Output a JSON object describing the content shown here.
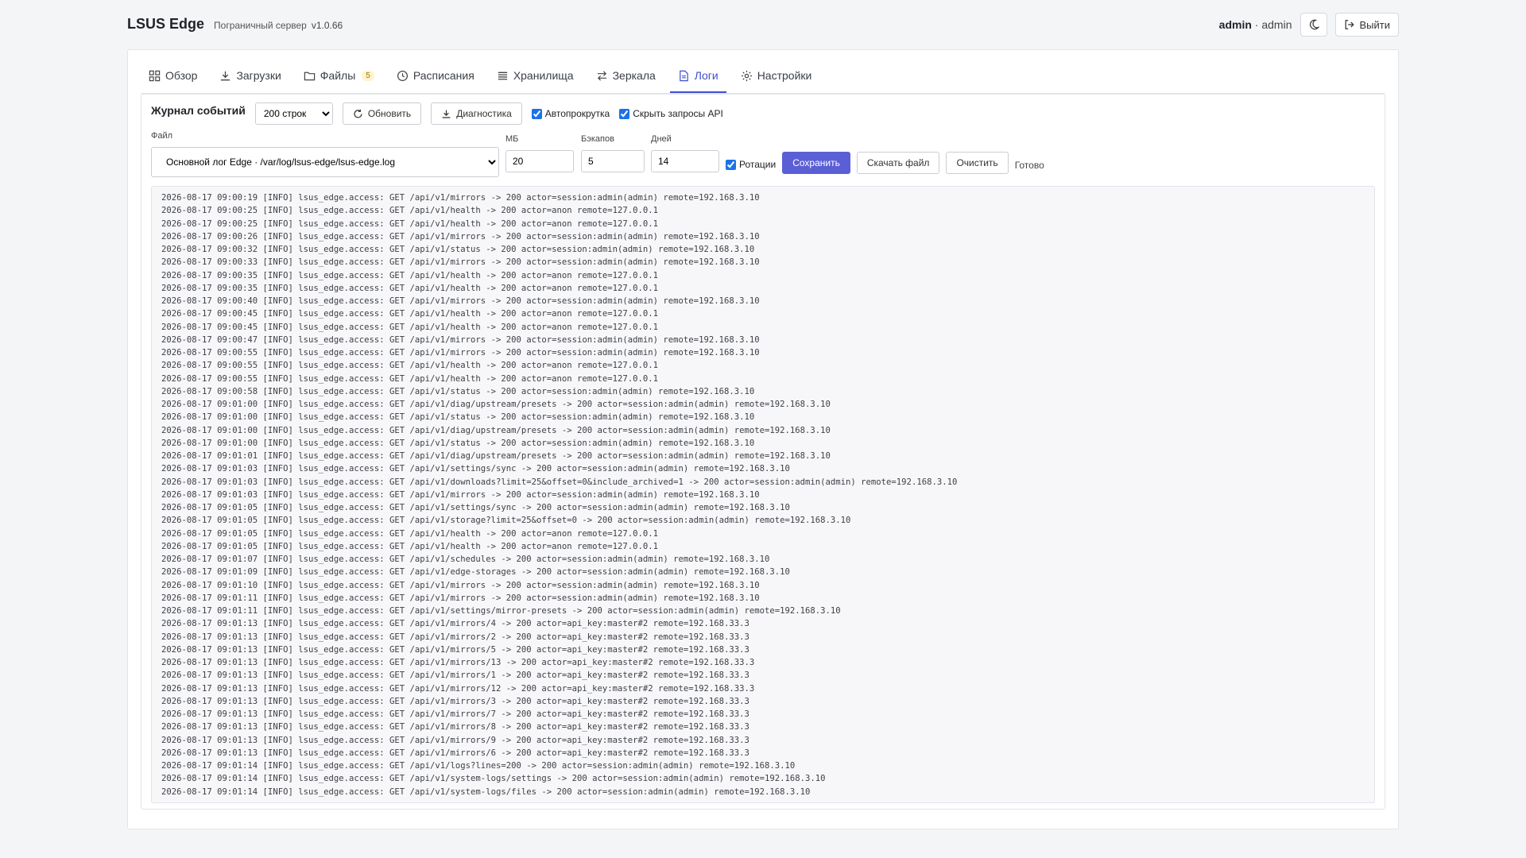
{
  "header": {
    "title": "LSUS Edge",
    "subtitle": "Пограничный сервер",
    "version": "v1.0.66",
    "user_name": "admin",
    "user_role": "admin",
    "logout_label": "Выйти"
  },
  "tabs": [
    {
      "label": "Обзор",
      "icon": "grid-icon"
    },
    {
      "label": "Загрузки",
      "icon": "download-icon"
    },
    {
      "label": "Файлы",
      "icon": "folder-icon",
      "badge": "5"
    },
    {
      "label": "Расписания",
      "icon": "clock-icon"
    },
    {
      "label": "Хранилища",
      "icon": "list-icon"
    },
    {
      "label": "Зеркала",
      "icon": "arrows-icon"
    },
    {
      "label": "Логи",
      "icon": "document-icon",
      "active": true
    },
    {
      "label": "Настройки",
      "icon": "gear-icon"
    }
  ],
  "logs": {
    "title": "Журнал событий",
    "lines_select": "200 строк",
    "refresh_label": "Обновить",
    "diagnostics_label": "Диагностика",
    "autoscroll_label": "Автопрокрутка",
    "hide_api_label": "Скрыть запросы API",
    "file_label": "Файл",
    "file_value": "Основной лог Edge · /var/log/lsus-edge/lsus-edge.log",
    "mb_label": "МБ",
    "mb_value": "20",
    "backups_label": "Бэкапов",
    "backups_value": "5",
    "days_label": "Дней",
    "days_value": "14",
    "rotation_label": "Ротации",
    "save_label": "Сохранить",
    "download_label": "Скачать файл",
    "clear_label": "Очистить",
    "status": "Готово",
    "accent_color": "#5b5fd6",
    "lines": [
      "2026-08-17 09:00:19 [INFO] lsus_edge.access: GET /api/v1/mirrors -> 200 actor=session:admin(admin) remote=192.168.3.10",
      "2026-08-17 09:00:25 [INFO] lsus_edge.access: GET /api/v1/health -> 200 actor=anon remote=127.0.0.1",
      "2026-08-17 09:00:25 [INFO] lsus_edge.access: GET /api/v1/health -> 200 actor=anon remote=127.0.0.1",
      "2026-08-17 09:00:26 [INFO] lsus_edge.access: GET /api/v1/mirrors -> 200 actor=session:admin(admin) remote=192.168.3.10",
      "2026-08-17 09:00:32 [INFO] lsus_edge.access: GET /api/v1/status -> 200 actor=session:admin(admin) remote=192.168.3.10",
      "2026-08-17 09:00:33 [INFO] lsus_edge.access: GET /api/v1/mirrors -> 200 actor=session:admin(admin) remote=192.168.3.10",
      "2026-08-17 09:00:35 [INFO] lsus_edge.access: GET /api/v1/health -> 200 actor=anon remote=127.0.0.1",
      "2026-08-17 09:00:35 [INFO] lsus_edge.access: GET /api/v1/health -> 200 actor=anon remote=127.0.0.1",
      "2026-08-17 09:00:40 [INFO] lsus_edge.access: GET /api/v1/mirrors -> 200 actor=session:admin(admin) remote=192.168.3.10",
      "2026-08-17 09:00:45 [INFO] lsus_edge.access: GET /api/v1/health -> 200 actor=anon remote=127.0.0.1",
      "2026-08-17 09:00:45 [INFO] lsus_edge.access: GET /api/v1/health -> 200 actor=anon remote=127.0.0.1",
      "2026-08-17 09:00:47 [INFO] lsus_edge.access: GET /api/v1/mirrors -> 200 actor=session:admin(admin) remote=192.168.3.10",
      "2026-08-17 09:00:55 [INFO] lsus_edge.access: GET /api/v1/mirrors -> 200 actor=session:admin(admin) remote=192.168.3.10",
      "2026-08-17 09:00:55 [INFO] lsus_edge.access: GET /api/v1/health -> 200 actor=anon remote=127.0.0.1",
      "2026-08-17 09:00:55 [INFO] lsus_edge.access: GET /api/v1/health -> 200 actor=anon remote=127.0.0.1",
      "2026-08-17 09:00:58 [INFO] lsus_edge.access: GET /api/v1/status -> 200 actor=session:admin(admin) remote=192.168.3.10",
      "2026-08-17 09:01:00 [INFO] lsus_edge.access: GET /api/v1/diag/upstream/presets -> 200 actor=session:admin(admin) remote=192.168.3.10",
      "2026-08-17 09:01:00 [INFO] lsus_edge.access: GET /api/v1/status -> 200 actor=session:admin(admin) remote=192.168.3.10",
      "2026-08-17 09:01:00 [INFO] lsus_edge.access: GET /api/v1/diag/upstream/presets -> 200 actor=session:admin(admin) remote=192.168.3.10",
      "2026-08-17 09:01:00 [INFO] lsus_edge.access: GET /api/v1/status -> 200 actor=session:admin(admin) remote=192.168.3.10",
      "2026-08-17 09:01:01 [INFO] lsus_edge.access: GET /api/v1/diag/upstream/presets -> 200 actor=session:admin(admin) remote=192.168.3.10",
      "2026-08-17 09:01:03 [INFO] lsus_edge.access: GET /api/v1/settings/sync -> 200 actor=session:admin(admin) remote=192.168.3.10",
      "2026-08-17 09:01:03 [INFO] lsus_edge.access: GET /api/v1/downloads?limit=25&offset=0&include_archived=1 -> 200 actor=session:admin(admin) remote=192.168.3.10",
      "2026-08-17 09:01:03 [INFO] lsus_edge.access: GET /api/v1/mirrors -> 200 actor=session:admin(admin) remote=192.168.3.10",
      "2026-08-17 09:01:05 [INFO] lsus_edge.access: GET /api/v1/settings/sync -> 200 actor=session:admin(admin) remote=192.168.3.10",
      "2026-08-17 09:01:05 [INFO] lsus_edge.access: GET /api/v1/storage?limit=25&offset=0 -> 200 actor=session:admin(admin) remote=192.168.3.10",
      "2026-08-17 09:01:05 [INFO] lsus_edge.access: GET /api/v1/health -> 200 actor=anon remote=127.0.0.1",
      "2026-08-17 09:01:05 [INFO] lsus_edge.access: GET /api/v1/health -> 200 actor=anon remote=127.0.0.1",
      "2026-08-17 09:01:07 [INFO] lsus_edge.access: GET /api/v1/schedules -> 200 actor=session:admin(admin) remote=192.168.3.10",
      "2026-08-17 09:01:09 [INFO] lsus_edge.access: GET /api/v1/edge-storages -> 200 actor=session:admin(admin) remote=192.168.3.10",
      "2026-08-17 09:01:10 [INFO] lsus_edge.access: GET /api/v1/mirrors -> 200 actor=session:admin(admin) remote=192.168.3.10",
      "2026-08-17 09:01:11 [INFO] lsus_edge.access: GET /api/v1/mirrors -> 200 actor=session:admin(admin) remote=192.168.3.10",
      "2026-08-17 09:01:11 [INFO] lsus_edge.access: GET /api/v1/settings/mirror-presets -> 200 actor=session:admin(admin) remote=192.168.3.10",
      "2026-08-17 09:01:13 [INFO] lsus_edge.access: GET /api/v1/mirrors/4 -> 200 actor=api_key:master#2 remote=192.168.33.3",
      "2026-08-17 09:01:13 [INFO] lsus_edge.access: GET /api/v1/mirrors/2 -> 200 actor=api_key:master#2 remote=192.168.33.3",
      "2026-08-17 09:01:13 [INFO] lsus_edge.access: GET /api/v1/mirrors/5 -> 200 actor=api_key:master#2 remote=192.168.33.3",
      "2026-08-17 09:01:13 [INFO] lsus_edge.access: GET /api/v1/mirrors/13 -> 200 actor=api_key:master#2 remote=192.168.33.3",
      "2026-08-17 09:01:13 [INFO] lsus_edge.access: GET /api/v1/mirrors/1 -> 200 actor=api_key:master#2 remote=192.168.33.3",
      "2026-08-17 09:01:13 [INFO] lsus_edge.access: GET /api/v1/mirrors/12 -> 200 actor=api_key:master#2 remote=192.168.33.3",
      "2026-08-17 09:01:13 [INFO] lsus_edge.access: GET /api/v1/mirrors/3 -> 200 actor=api_key:master#2 remote=192.168.33.3",
      "2026-08-17 09:01:13 [INFO] lsus_edge.access: GET /api/v1/mirrors/7 -> 200 actor=api_key:master#2 remote=192.168.33.3",
      "2026-08-17 09:01:13 [INFO] lsus_edge.access: GET /api/v1/mirrors/8 -> 200 actor=api_key:master#2 remote=192.168.33.3",
      "2026-08-17 09:01:13 [INFO] lsus_edge.access: GET /api/v1/mirrors/9 -> 200 actor=api_key:master#2 remote=192.168.33.3",
      "2026-08-17 09:01:13 [INFO] lsus_edge.access: GET /api/v1/mirrors/6 -> 200 actor=api_key:master#2 remote=192.168.33.3",
      "2026-08-17 09:01:14 [INFO] lsus_edge.access: GET /api/v1/logs?lines=200 -> 200 actor=session:admin(admin) remote=192.168.3.10",
      "2026-08-17 09:01:14 [INFO] lsus_edge.access: GET /api/v1/system-logs/settings -> 200 actor=session:admin(admin) remote=192.168.3.10",
      "2026-08-17 09:01:14 [INFO] lsus_edge.access: GET /api/v1/system-logs/files -> 200 actor=session:admin(admin) remote=192.168.3.10"
    ]
  }
}
